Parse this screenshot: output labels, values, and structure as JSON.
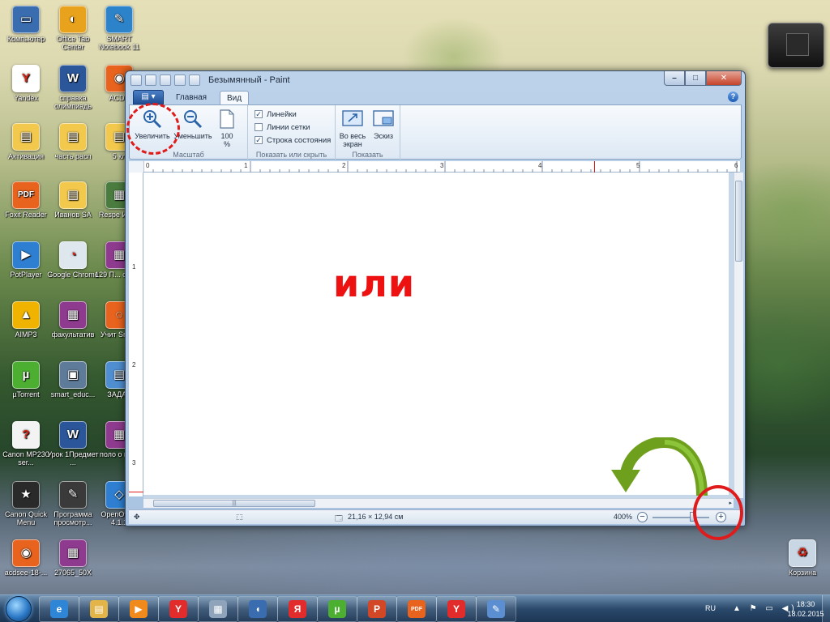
{
  "desktop": {
    "icons": [
      {
        "label": "Компьютер",
        "color": "#3a6db0",
        "glyph": "▭"
      },
      {
        "label": "Office Tab Center",
        "color": "#e9a21b",
        "glyph": "◐"
      },
      {
        "label": "SMART Notebook 11",
        "color": "#2d83c9",
        "glyph": "✎"
      },
      {
        "label": "Yandex",
        "color": "#ffffff",
        "glyph": "Y"
      },
      {
        "label": "справка олимпиадь",
        "color": "#2b579a",
        "glyph": "W"
      },
      {
        "label": "ACDS",
        "color": "#e8631d",
        "glyph": "◉"
      },
      {
        "label": "Активация",
        "color": "#f2c94c",
        "glyph": "▤"
      },
      {
        "label": "часть расп",
        "color": "#f2c94c",
        "glyph": "▤"
      },
      {
        "label": "5 кл",
        "color": "#f2c94c",
        "glyph": "▤"
      },
      {
        "label": "Foxit Reader",
        "color": "#e8631d",
        "glyph": "PDF"
      },
      {
        "label": "Иванов SA",
        "color": "#f2c94c",
        "glyph": "▤"
      },
      {
        "label": "Respe Имит",
        "color": "#4a7b3f",
        "glyph": "▦"
      },
      {
        "label": "PotPlayer",
        "color": "#2e7fd1",
        "glyph": "▶"
      },
      {
        "label": "Google Chrome",
        "color": "#dfe7ee",
        "glyph": "◔"
      },
      {
        "label": "129 П... о сост",
        "color": "#8e3a8e",
        "glyph": "▦"
      },
      {
        "label": "AIMP3",
        "color": "#f0b400",
        "glyph": "▲"
      },
      {
        "label": "факультатив",
        "color": "#8e3a8e",
        "glyph": "▦"
      },
      {
        "label": "Учит Smart",
        "color": "#e8631d",
        "glyph": "◌"
      },
      {
        "label": "µTorrent",
        "color": "#4caf32",
        "glyph": "µ"
      },
      {
        "label": "smart_educ...",
        "color": "#5f7b9a",
        "glyph": "▣"
      },
      {
        "label": "ЗАДАЧ",
        "color": "#4f8fd1",
        "glyph": "▤"
      },
      {
        "label": "Canon MP230 ser...",
        "color": "#f3f3f3",
        "glyph": "?"
      },
      {
        "label": "Урок 1Предмет ...",
        "color": "#2b579a",
        "glyph": "W"
      },
      {
        "label": "поло о конк",
        "color": "#8e3a8e",
        "glyph": "▦"
      },
      {
        "label": "Canon Quick Menu",
        "color": "#2a2a2a",
        "glyph": "★"
      },
      {
        "label": "Программа просмотр...",
        "color": "#3a3a3a",
        "glyph": "✎"
      },
      {
        "label": "OpenOffice 4.1.1",
        "color": "#2e7fd1",
        "glyph": "◇"
      },
      {
        "label": "acdsee-18-...",
        "color": "#e8631d",
        "glyph": "◉"
      },
      {
        "label": "27065_50X",
        "color": "#8e3a8e",
        "glyph": "▦"
      },
      {
        "label": "Корзина",
        "color": "#c9d6e3",
        "glyph": "♻"
      }
    ]
  },
  "window": {
    "title": "Безымянный - Paint",
    "controls": {
      "minimize": "–",
      "maximize": "□",
      "close": "✕"
    }
  },
  "ribbon": {
    "app_menu": "▤ ▾",
    "tabs": [
      "Главная",
      "Вид"
    ],
    "active_tab": "Вид",
    "help": "?",
    "zoom_group": {
      "zoom_in": "Увеличить",
      "zoom_out": "Уменьшить",
      "percent": "100\n%",
      "label": "Масштаб"
    },
    "show_hide_group": {
      "rulers": {
        "label": "Линейки",
        "checked": "✓"
      },
      "gridlines": {
        "label": "Линии сетки",
        "checked": ""
      },
      "statusbar": {
        "label": "Строка состояния",
        "checked": "✓"
      },
      "label": "Показать или скрыть"
    },
    "display_group": {
      "fullscreen": "Во весь экран",
      "thumbnail": "Эскиз",
      "label": "Показать"
    }
  },
  "rulers": {
    "h_marks": [
      "0",
      "1",
      "2",
      "3",
      "4",
      "5",
      "6"
    ],
    "v_marks": [
      "1",
      "2",
      "3"
    ]
  },
  "canvas": {
    "text": "или",
    "text_color": "#ee1111"
  },
  "scrollbars": {
    "h_grip": "|||",
    "right_arrow": "▸"
  },
  "status": {
    "move_icon": "✥",
    "selection_icon": "⬚",
    "size_icon": "🗔",
    "size": "21,16 × 12,94 см",
    "zoom_level": "400%",
    "zoom_minus": "−",
    "zoom_plus": "+"
  },
  "taskbar": {
    "apps": [
      {
        "name": "ie",
        "glyph": "e",
        "color": "#2f86d6"
      },
      {
        "name": "explorer",
        "glyph": "▤",
        "color": "#e3b448"
      },
      {
        "name": "media-player",
        "glyph": "▶",
        "color": "#f08a1c"
      },
      {
        "name": "yandex",
        "glyph": "Y",
        "color": "#e22b2b"
      },
      {
        "name": "calculator",
        "glyph": "▦",
        "color": "#8fa4bb"
      },
      {
        "name": "audio",
        "glyph": "◖",
        "color": "#3a6db0"
      },
      {
        "name": "yandex-browser",
        "glyph": "Я",
        "color": "#e22b2b"
      },
      {
        "name": "utorrent",
        "glyph": "µ",
        "color": "#4caf32"
      },
      {
        "name": "powerpoint",
        "glyph": "P",
        "color": "#d24726"
      },
      {
        "name": "pdf",
        "glyph": "PDF",
        "color": "#e8631d"
      },
      {
        "name": "yandex-2",
        "glyph": "Y",
        "color": "#e22b2b"
      },
      {
        "name": "paint",
        "glyph": "✎",
        "color": "#5b8fd1"
      }
    ],
    "tray": {
      "lang": "RU",
      "icons": "▲ ⚑ ▭ ◀)",
      "time": "18:30",
      "date": "18.02.2015"
    }
  }
}
